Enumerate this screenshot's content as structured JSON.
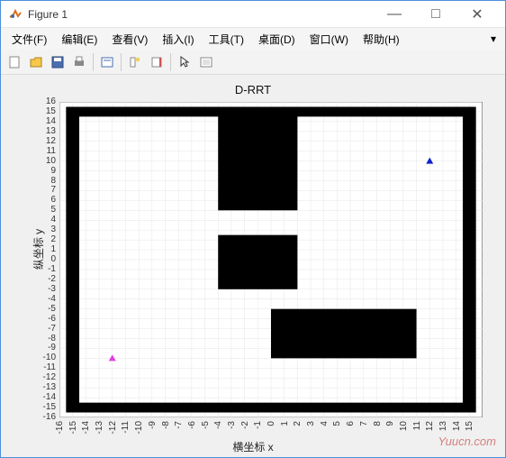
{
  "window": {
    "title": "Figure 1",
    "minimize": "—",
    "maximize": "□",
    "close": "✕"
  },
  "menu": {
    "file": "文件(F)",
    "edit": "编辑(E)",
    "view": "查看(V)",
    "insert": "插入(I)",
    "tools": "工具(T)",
    "desktop": "桌面(D)",
    "window": "窗口(W)",
    "help": "帮助(H)",
    "dropdown": "▾"
  },
  "watermark": "Yuucn.com",
  "chart_data": {
    "type": "scatter",
    "title": "D-RRT",
    "xlabel": "横坐标 x",
    "ylabel": "纵坐标 y",
    "xlim": [
      -16,
      16
    ],
    "ylim": [
      -16,
      16
    ],
    "xticks": [
      -16,
      -15,
      -14,
      -13,
      -12,
      -11,
      -10,
      -9,
      -8,
      -7,
      -6,
      -5,
      -4,
      -3,
      -2,
      -1,
      0,
      1,
      2,
      3,
      4,
      5,
      6,
      7,
      8,
      9,
      10,
      11,
      12,
      13,
      14,
      15
    ],
    "yticks": [
      -16,
      -15,
      -14,
      -13,
      -12,
      -11,
      -10,
      -9,
      -8,
      -7,
      -6,
      -5,
      -4,
      -3,
      -2,
      -1,
      0,
      1,
      2,
      3,
      4,
      5,
      6,
      7,
      8,
      9,
      10,
      11,
      12,
      13,
      14,
      15,
      16
    ],
    "grid": true,
    "obstacles": [
      {
        "type": "border",
        "outer": [
          -15.5,
          15.5
        ],
        "inner": [
          -14.5,
          14.5
        ]
      },
      {
        "type": "rect",
        "x1": -4,
        "y1": 5,
        "x2": 2,
        "y2": 15
      },
      {
        "type": "rect",
        "x1": -4,
        "y1": -3,
        "x2": 2,
        "y2": 2.5
      },
      {
        "type": "rect",
        "x1": 0,
        "y1": -10,
        "x2": 11,
        "y2": -5
      }
    ],
    "points": [
      {
        "name": "start",
        "x": -12,
        "y": -10,
        "color": "#e040e0",
        "marker": "triangle"
      },
      {
        "name": "goal",
        "x": 12,
        "y": 10,
        "color": "#1020d0",
        "marker": "triangle"
      }
    ]
  }
}
